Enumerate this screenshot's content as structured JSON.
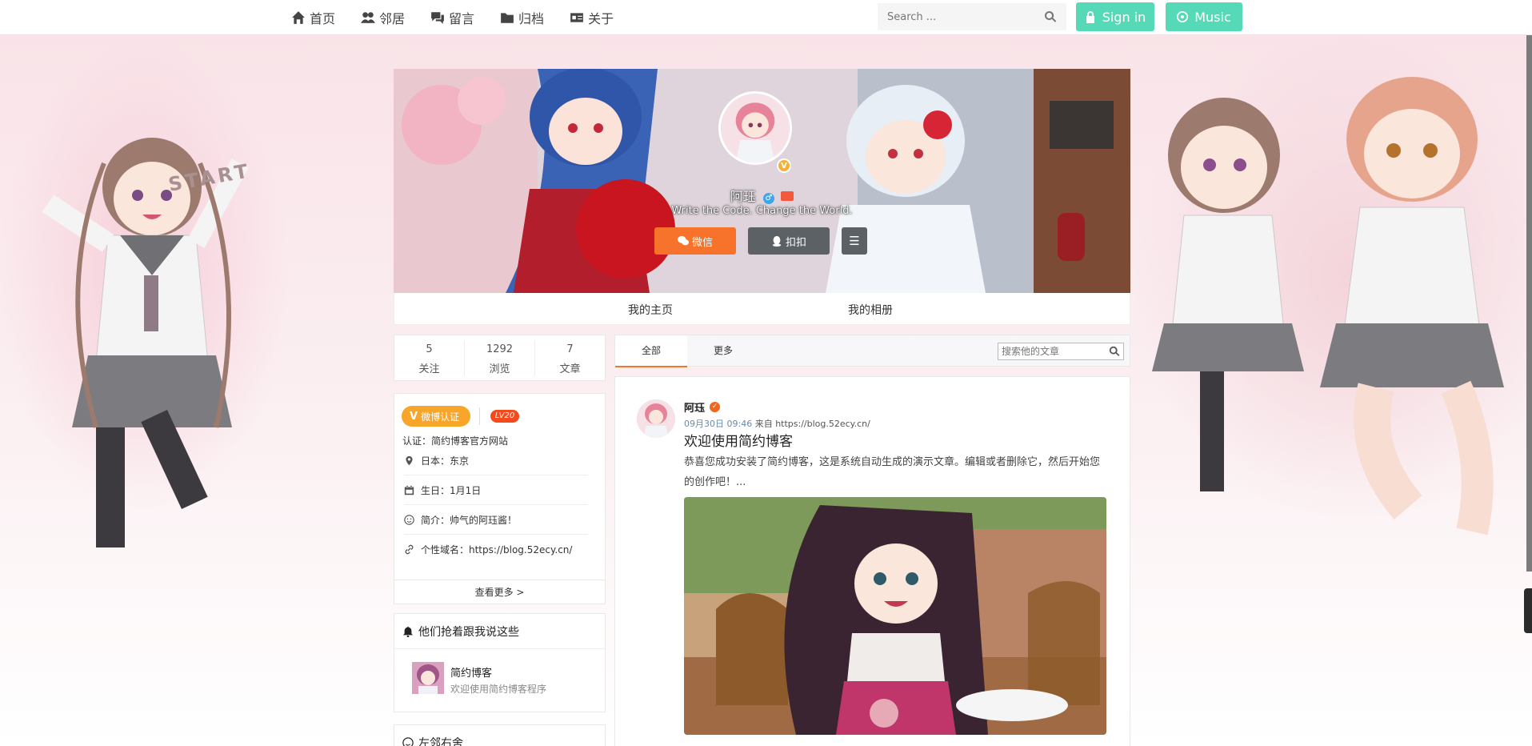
{
  "nav": {
    "links": [
      {
        "label": "首页",
        "icon": "home-icon"
      },
      {
        "label": "邻居",
        "icon": "users-icon"
      },
      {
        "label": "留言",
        "icon": "comments-icon"
      },
      {
        "label": "归档",
        "icon": "folder-icon"
      },
      {
        "label": "关于",
        "icon": "id-card-icon"
      }
    ],
    "search_placeholder": "Search ...",
    "signin_label": "Sign in",
    "music_label": "Music"
  },
  "background": {
    "start_text": "START"
  },
  "cover": {
    "name": "阿珏",
    "gender_symbol": "♂",
    "verified_mark": "V",
    "motto": "Write the Code. Change the World.",
    "wechat_label": "微信",
    "qq_label": "扣扣",
    "menu_label": "☰",
    "tabs": [
      "我的主页",
      "我的相册"
    ]
  },
  "stats": [
    {
      "num": "5",
      "label": "关注"
    },
    {
      "num": "1292",
      "label": "浏览"
    },
    {
      "num": "7",
      "label": "文章"
    }
  ],
  "profile": {
    "weibo_badge": "微博认证",
    "weibo_mark": "V",
    "level": "LV20",
    "cert": "认证：简约博客官方网站",
    "rows": [
      {
        "icon": "location-icon",
        "text": "日本：东京"
      },
      {
        "icon": "calendar-icon",
        "text": "生日：1月1日"
      },
      {
        "icon": "smile-icon",
        "text": "简介：帅气的阿珏酱！"
      },
      {
        "icon": "link-icon",
        "text": "个性域名：https://blog.52ecy.cn/"
      }
    ],
    "see_more": "查看更多 >"
  },
  "rush": {
    "title": "他们抢着跟我说这些",
    "item_name": "简约博客",
    "item_desc": "欢迎使用简约博客程序"
  },
  "neighbor": {
    "title": "左邻右舍"
  },
  "post_tabs": {
    "tabs": [
      "全部",
      "更多"
    ],
    "search_placeholder": "搜索他的文章"
  },
  "post": {
    "author": "阿珏",
    "verified_mark": "✓",
    "time": "09月30日 09:46",
    "source": " 来自 https://blog.52ecy.cn/",
    "title": "欢迎使用简约博客",
    "excerpt": "恭喜您成功安装了简约博客，这是系统自动生成的演示文章。编辑或者删除它，然后开始您的创作吧！..."
  },
  "colors": {
    "accent_green": "#56d9b6",
    "accent_orange": "#f7722a",
    "dark_button": "#5c6166"
  }
}
